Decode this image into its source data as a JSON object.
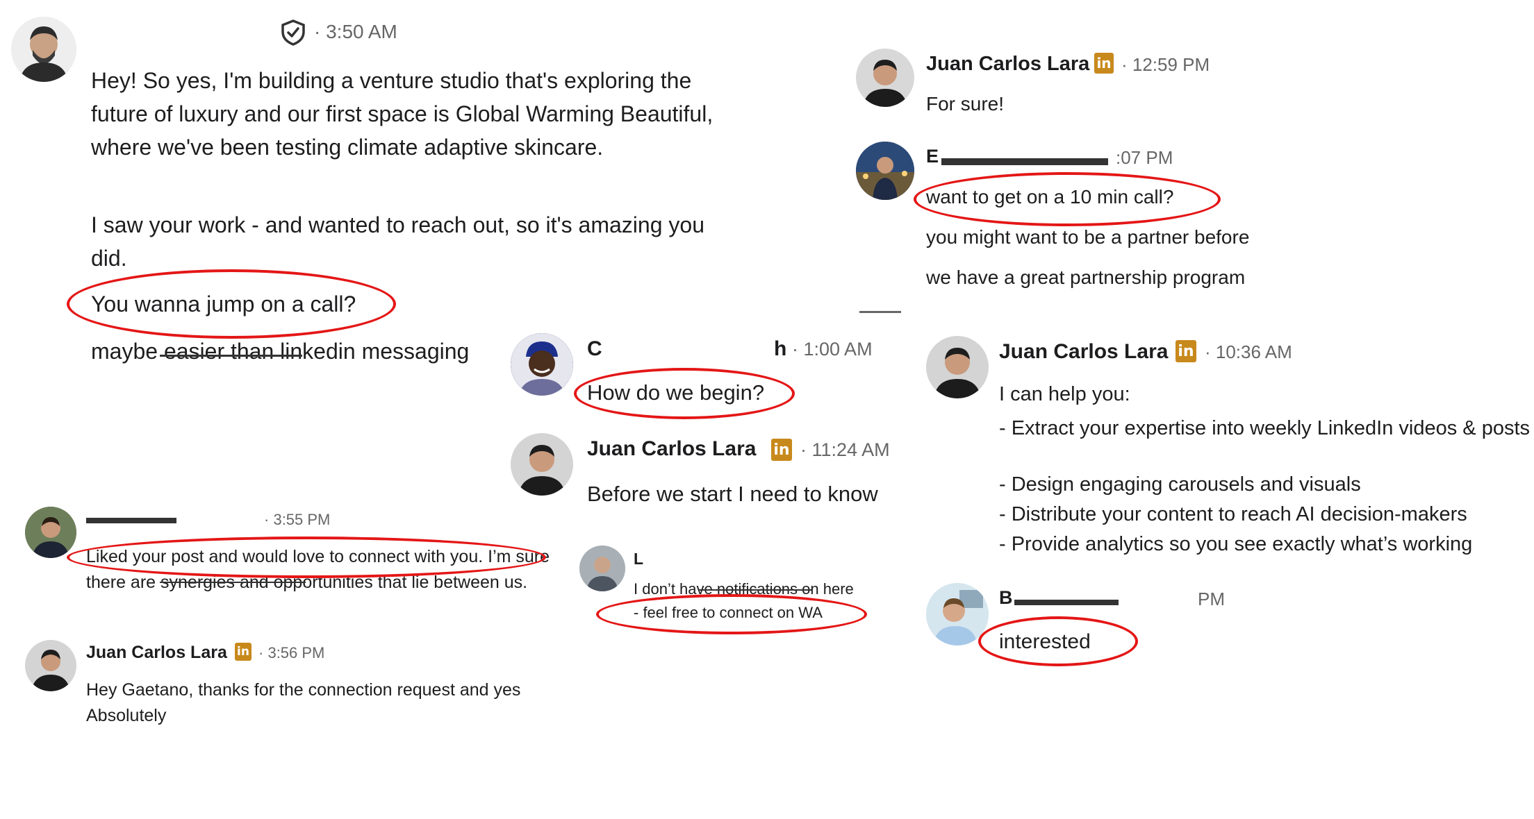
{
  "colors": {
    "highlight": "#e41616",
    "linkedin_badge": "#c8891c",
    "text": "#1d1d1f",
    "meta": "#666666"
  },
  "linkedin_badge": {
    "icon": "linkedin-icon",
    "text": "in"
  },
  "chat1": {
    "time": "3:50 AM",
    "shield_icon": "shield-check-icon",
    "p1": "Hey! So yes, I'm building a venture studio that's exploring the future of luxury and our first space is Global Warming Beautiful, where we've been testing climate adaptive skincare.",
    "p2": "I saw your work - and wanted to reach out, so it's amazing you did.",
    "p3": "You wanna jump on a call?",
    "p4": "maybe easier than linkedin messaging"
  },
  "chat2": {
    "m1_name": "Juan Carlos Lara",
    "m1_time": "12:59 PM",
    "m1_text": "For sure!",
    "m2_name_partial": "E",
    "m2_time": ":07 PM",
    "m2_text1": "want to get on a 10 min call?",
    "m2_text2": "you might want to be a partner before",
    "m2_text3": "we have a great partnership program"
  },
  "chat3": {
    "m1_name_start": "C",
    "m1_name_end": "h",
    "m1_time": "1:00 AM",
    "m1_text": "How do we begin?",
    "m2_name": "Juan Carlos Lara",
    "m2_time": "11:24 AM",
    "m2_text": "Before we start I need to know"
  },
  "chat4": {
    "m1_time": "3:55 PM",
    "m1_text": "Liked your post and would love to connect with you. I’m sure there are synergies and opportunities that lie between us.",
    "m2_name": "Juan Carlos Lara",
    "m2_time": "3:56 PM",
    "m2_text": "Hey Gaetano, thanks for the connection request and yes Absolutely"
  },
  "chat5": {
    "name_partial": "L",
    "line1": "I don’t have notifications on here",
    "line2": "- feel free to connect on WA"
  },
  "chat6": {
    "name": "Juan Carlos Lara",
    "time": "10:36 AM",
    "lines": [
      "I can help you:",
      "- Extract your expertise into weekly LinkedIn videos & posts",
      "- Design engaging carousels and visuals",
      "- Distribute your content to reach AI decision-makers",
      "- Provide analytics so you see exactly what’s working"
    ]
  },
  "chat7": {
    "name_partial": "B",
    "time_partial": "PM",
    "text": "interested"
  }
}
